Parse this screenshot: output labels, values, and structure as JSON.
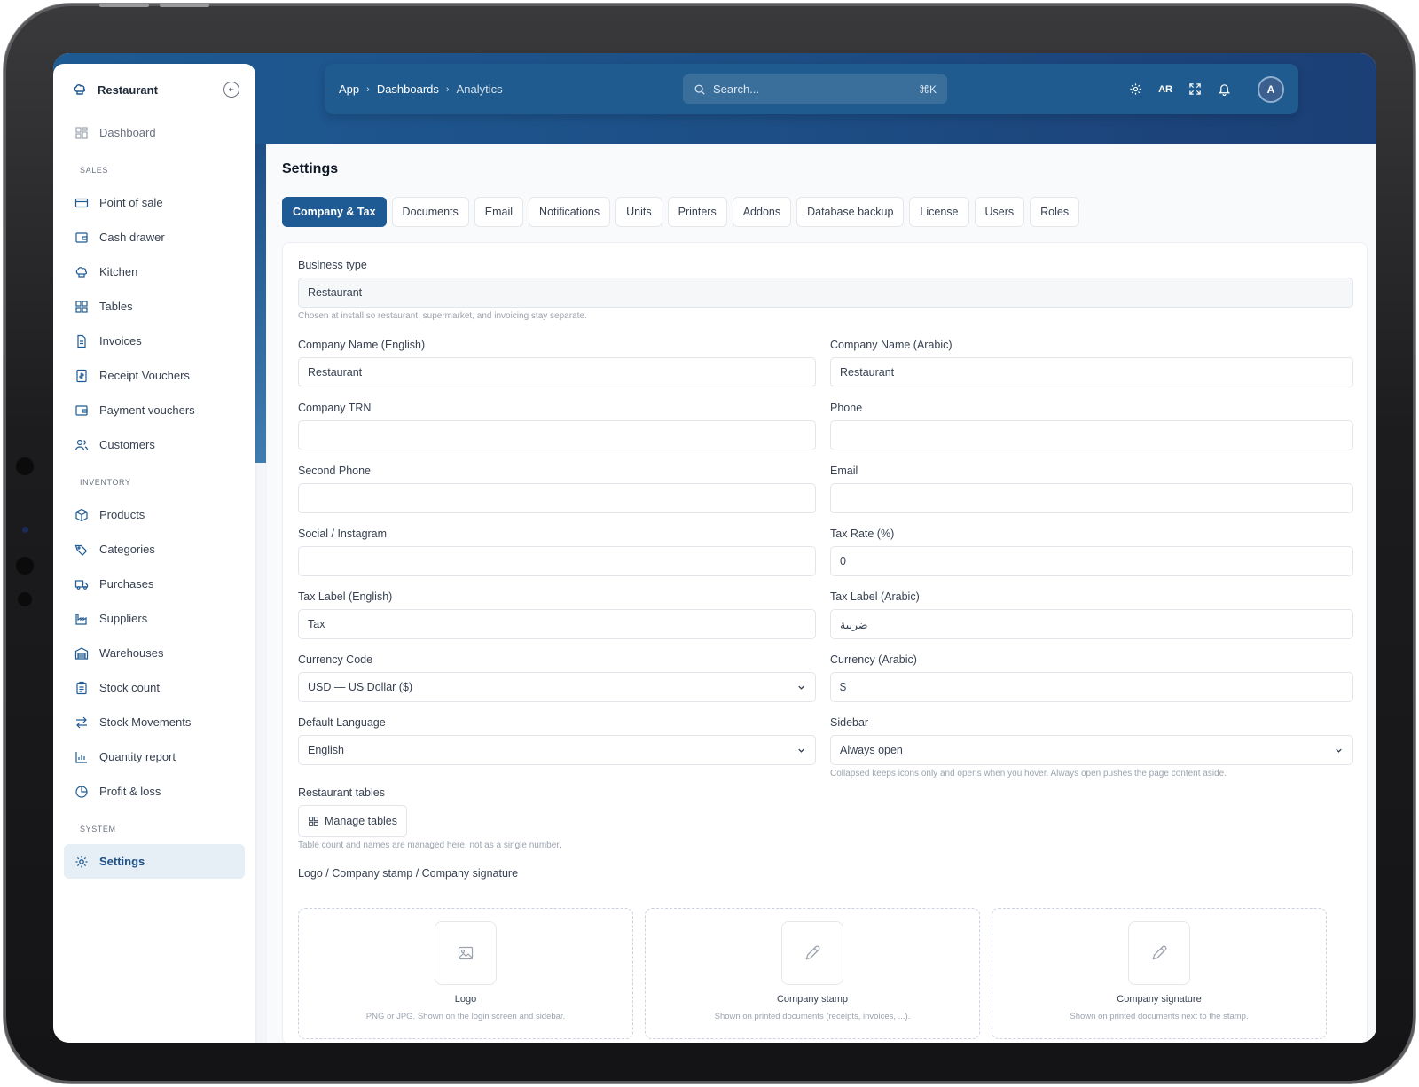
{
  "app": {
    "sidebar": {
      "brand": "Restaurant",
      "dashboard": "Dashboard",
      "sections": [
        {
          "title": "SALES",
          "items": [
            "Point of sale",
            "Cash drawer",
            "Kitchen",
            "Tables",
            "Invoices",
            "Receipt Vouchers",
            "Payment vouchers",
            "Customers"
          ]
        },
        {
          "title": "INVENTORY",
          "items": [
            "Products",
            "Categories",
            "Purchases",
            "Suppliers",
            "Warehouses",
            "Stock count",
            "Stock Movements",
            "Quantity report",
            "Profit & loss"
          ]
        },
        {
          "title": "SYSTEM",
          "items": [
            "Settings"
          ]
        }
      ]
    },
    "topbar": {
      "breadcrumb": [
        "App",
        "Dashboards",
        "Analytics"
      ],
      "search_placeholder": "Search...",
      "search_shortcut": "⌘K",
      "language": "AR",
      "avatar_initial": "A"
    }
  },
  "page": {
    "title": "Settings",
    "tabs": [
      "Company & Tax",
      "Documents",
      "Email",
      "Notifications",
      "Units",
      "Printers",
      "Addons",
      "Database backup",
      "License",
      "Users",
      "Roles"
    ],
    "form": {
      "business_type": {
        "label": "Business type",
        "value": "Restaurant",
        "hint": "Chosen at install so restaurant, supermarket, and invoicing stay separate."
      },
      "company_name_en": {
        "label": "Company Name (English)",
        "value": "Restaurant"
      },
      "company_name_ar": {
        "label": "Company Name (Arabic)",
        "value": "Restaurant"
      },
      "company_trn": {
        "label": "Company TRN",
        "value": ""
      },
      "phone": {
        "label": "Phone",
        "value": ""
      },
      "second_phone": {
        "label": "Second Phone",
        "value": ""
      },
      "email": {
        "label": "Email",
        "value": ""
      },
      "social": {
        "label": "Social / Instagram",
        "value": ""
      },
      "tax_rate": {
        "label": "Tax Rate (%)",
        "value": "0"
      },
      "tax_label_en": {
        "label": "Tax Label (English)",
        "value": "Tax"
      },
      "tax_label_ar": {
        "label": "Tax Label (Arabic)",
        "value": "ضريبة"
      },
      "currency_code": {
        "label": "Currency Code",
        "value": "USD — US Dollar ($)"
      },
      "currency_ar": {
        "label": "Currency (Arabic)",
        "value": "$"
      },
      "default_language": {
        "label": "Default Language",
        "value": "English"
      },
      "sidebar_mode": {
        "label": "Sidebar",
        "value": "Always open",
        "hint": "Collapsed keeps icons only and opens when you hover. Always open pushes the page content aside."
      },
      "restaurant_tables": {
        "label": "Restaurant tables",
        "button": "Manage tables",
        "hint": "Table count and names are managed here, not as a single number."
      },
      "uploads": {
        "label": "Logo / Company stamp / Company signature",
        "items": [
          {
            "title": "Logo",
            "sub": "PNG or JPG. Shown on the login screen and sidebar.",
            "icon": "image-icon"
          },
          {
            "title": "Company stamp",
            "sub": "Shown on printed documents (receipts, invoices, ...).",
            "icon": "pencil-icon"
          },
          {
            "title": "Company signature",
            "sub": "Shown on printed documents next to the stamp.",
            "icon": "pencil-icon"
          }
        ]
      }
    }
  },
  "colors": {
    "accent": "#1e5a93",
    "header": "#1f5b8e"
  }
}
